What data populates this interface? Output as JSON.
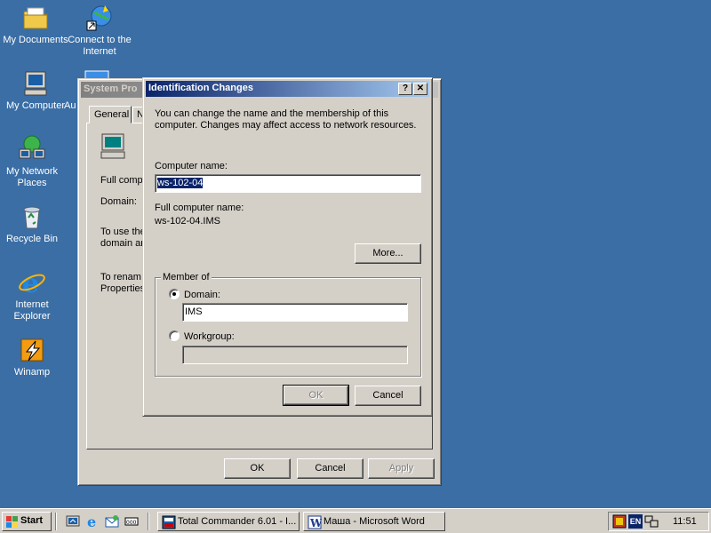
{
  "desktop": {
    "icons": [
      {
        "label": "My Documents"
      },
      {
        "label": "Connect to the Internet"
      },
      {
        "label": "My Computer"
      },
      {
        "label": "Au"
      },
      {
        "label": "My Network Places"
      },
      {
        "label": "Recycle Bin"
      },
      {
        "label": "Internet Explorer"
      },
      {
        "label": "Winamp"
      }
    ]
  },
  "system_properties": {
    "title": "System Pro",
    "tab_general": "General",
    "tab_next": "N",
    "full_computer": "Full compu",
    "domain": "Domain:",
    "to_use_1": "To use the",
    "to_use_2": "domain an",
    "to_rename_1": "To renam",
    "to_rename_2": "Properties",
    "ok": "OK",
    "cancel": "Cancel",
    "apply": "Apply"
  },
  "dialog": {
    "title": "Identification Changes",
    "help_btn": "?",
    "close_btn": "✕",
    "intro_line1": "You can change the name and the membership of this",
    "intro_line2": "computer. Changes may affect access to network resources.",
    "computer_name_label": "Computer name:",
    "computer_name_value": "ws-102-04",
    "full_name_label": "Full computer name:",
    "full_name_value": "ws-102-04.IMS",
    "more_button": "More...",
    "member_of": "Member of",
    "domain_label": "Domain:",
    "domain_value": "IMS",
    "workgroup_label": "Workgroup:",
    "workgroup_value": "",
    "ok": "OK",
    "cancel": "Cancel"
  },
  "taskbar": {
    "start": "Start",
    "tasks": [
      {
        "label": "Total Commander 6.01 - I..."
      },
      {
        "label": "Маша - Microsoft Word"
      }
    ],
    "lang": "EN",
    "clock": "11:51"
  }
}
